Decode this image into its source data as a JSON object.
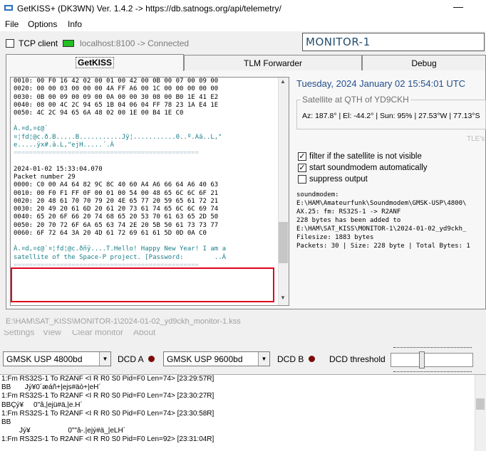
{
  "window": {
    "title": "GetKISS+ (DK3WN) Ver. 1.4.2 -> https://db.satnogs.org/api/telemetry/",
    "minimize_glyph": "—"
  },
  "menu": [
    "File",
    "Options",
    "Info"
  ],
  "connection": {
    "tcp_label": "TCP client",
    "status": "localhost:8100 -> Connected",
    "led_color": "#22c022"
  },
  "monitor_name": "MONITOR-1",
  "tabs": [
    "GetKISS",
    "TLM Forwarder",
    "Debug"
  ],
  "log": {
    "block1_hex": "0010: 00 F0 16 42 02 00 01 00 42 00 0B 00 07 00 09 00\n0020: 00 00 03 00 00 00 4A FF A6 00 1C 00 00 00 00 00\n0030: 0B 00 09 00 09 00 0A 00 00 30 08 00 B0 1E 41 E2\n0040: 08 00 4C 2C 94 65 1B 04 06 04 FF 78 23 1A E4 1E\n0050: 4C 2C 94 65 6A 48 02 00 1E 00 B4 1E C0",
    "block1_ascii": "À.¤d,¤¢@`\n¤¦fd¦@c.ð.B.....B...........Jÿ¦...........0..º.Aâ..L,\"\ne.....ÿx#.ä.L,\"ejH.....´.À",
    "separator": "================================================",
    "timestamp": "2024-01-02 15:33:04.070",
    "packet_number": "Packet number 29",
    "block2_hex": "0000: C0 00 A4 64 82 9C 8C 40 60 A4 A6 66 64 A6 40 63\n0010: 00 F0 F1 FF 0F 00 01 00 54 00 48 65 6C 6C 6F 21\n0020: 20 48 61 70 70 79 20 4E 65 77 20 59 65 61 72 21\n0030: 20 49 20 61 6D 20 61 20 73 61 74 65 6C 6C 69 74\n0040: 65 20 6F 66 20 74 68 65 20 53 70 61 63 65 2D 50\n0050: 20 70 72 6F 6A 65 63 74 2E 20 5B 50 61 73 73 77\n0060: 6F 72 64 3A 20 4D 61 72 69 61 61 5D 0D 0A C0",
    "block2_ascii": "À.¤d,¤¢@`¤¦fd¦@c.ðñÿ....T.Hello! Happy New Year! I am a\nsatellite of the Space-P project. [Password:        ..À",
    "separator2": "================================================"
  },
  "info": {
    "datetime": "Tuesday, 2024 January 02  15:54:01 UTC",
    "sat_group_label": "Satellite at QTH of YD9CKH",
    "sat_position": "Az: 187.8° | El: -44.2° | Sun: 95% | 27.53°W | 77.13°S",
    "tle_label": "TLE's",
    "checkboxes": [
      {
        "label": "filter if the satellite is not visible",
        "checked": true
      },
      {
        "label": "start soundmodem automatically",
        "checked": true
      },
      {
        "label": "suppress output",
        "checked": false
      }
    ],
    "soundmodem_log": "soundmodem:\nE:\\HAM\\Amateurfunk\\Soundmodem\\GMSK-USP\\4800\\\nAX.25: fm: RS32S-1 -> R2ANF\n228 bytes has been added to\nE:\\HAM\\SAT_KISS\\MONITOR-1\\2024-01-02_yd9ckh_\nFilesize: 1883 bytes\nPackets: 30 | Size: 228 byte | Total Bytes: 1"
  },
  "file_path": "E:\\HAM\\SAT_KISS\\MONITOR-1\\2024-01-02_yd9ckh_monitor-1.kss",
  "bottom_menu": [
    "Settings",
    "View",
    "Clear monitor",
    "About"
  ],
  "controls": {
    "combo_a": "GMSK USP 4800bd",
    "dcd_a_label": "DCD A",
    "combo_b": "GMSK USP 9600bd",
    "dcd_b_label": "DCD B",
    "dcd_threshold_label": "DCD threshold",
    "dcd_threshold_level": 0.38,
    "led_color": "#7a0b0b"
  },
  "packets": [
    "1:Fm RS32S-1 To R2ANF <I R R0 S0 Pid=F0 Len=74> [23:29:57R]",
    "BB       Jý¥0´æáñ+|ejs#äò+|eH´",
    "1:Fm RS32S-1 To R2ANF <I R R0 S0 Pid=F0 Len=74> [23:30:27R]",
    "BBÇý¥     0\"â,|ejü#ä,|e.H´",
    "1:Fm RS32S-1 To R2ANF <I R R0 S0 Pid=F0 Len=74> [23:30:58R]",
    "BB",
    "         Jý¥                   0\"\"â-.|ejý#ä_|eLH´",
    "1:Fm RS32S-1 To R2ANF <I R R0 S0 Pid=F0 Len=92> [23:31:04R]"
  ]
}
